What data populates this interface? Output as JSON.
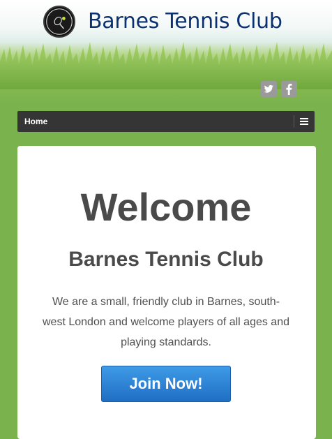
{
  "header": {
    "logo": {
      "name": "barnes-tennis-club-logo",
      "text": "BARNES TENNIS CLUB"
    },
    "site_title": "Barnes Tennis Club",
    "social": {
      "twitter_icon": "twitter-icon",
      "facebook_icon": "facebook-icon"
    }
  },
  "nav": {
    "items": [
      {
        "label": "Home"
      }
    ],
    "menu_icon": "hamburger-menu-icon"
  },
  "main": {
    "heading": "Welcome",
    "subheading": "Barnes Tennis Club",
    "intro": "We are a small, friendly club in Barnes, south-west London and welcome players of all ages and playing standards.",
    "cta_label": "Join Now!"
  },
  "colors": {
    "title_blue": "#0b3170",
    "grass_green": "#7ab24e",
    "nav_dark": "#353535",
    "button_blue": "#2f84d6",
    "heading_gray": "#4a4a4a"
  }
}
